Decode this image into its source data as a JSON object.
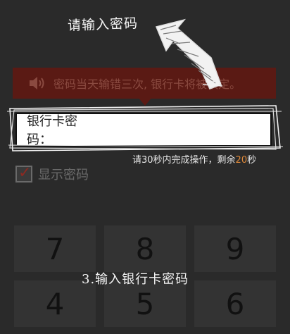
{
  "annotations": {
    "top": "请输入密码",
    "bottom": "3.输入银行卡密码"
  },
  "warning": {
    "icon": "speaker-icon",
    "text": "密码当天输错三次, 银行卡将被锁定。"
  },
  "password_field": {
    "label": "银行卡密码：",
    "value": ""
  },
  "timer": {
    "prefix": "请30秒内完成操作，剩余",
    "seconds": "20",
    "suffix": "秒"
  },
  "show_password": {
    "label": "显示密码",
    "checked": true
  },
  "keypad": {
    "keys": [
      "7",
      "8",
      "9",
      "4",
      "5",
      "6"
    ]
  },
  "colors": {
    "background": "#2a2a2a",
    "warning_bg": "#5a1a14",
    "countdown": "#e08a3a"
  }
}
